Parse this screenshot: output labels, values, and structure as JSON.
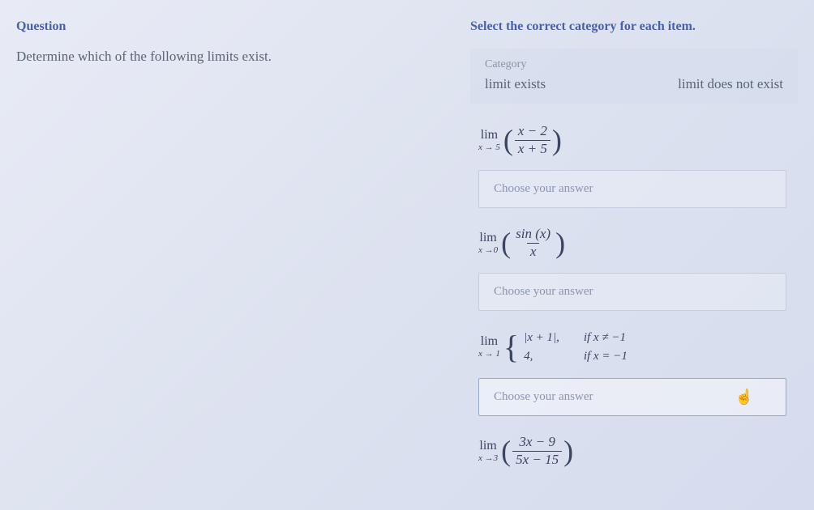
{
  "left": {
    "heading": "Question",
    "text": "Determine which of the following limits exist."
  },
  "right": {
    "instruction": "Select the correct category for each item.",
    "category": {
      "label": "Category",
      "opt1": "limit exists",
      "opt2": "limit does not exist"
    },
    "items": [
      {
        "lim_var": "x → 5",
        "frac_num": "x − 2",
        "frac_den": "x + 5",
        "placeholder": "Choose your answer"
      },
      {
        "lim_var": "x →0",
        "frac_num": "sin (x)",
        "frac_den": "x",
        "placeholder": "Choose your answer"
      },
      {
        "lim_var": "x → 1",
        "piece1_val": "|x + 1|,",
        "piece1_cond": "if x ≠ −1",
        "piece2_val": "4,",
        "piece2_cond": "if x = −1",
        "placeholder": "Choose your answer"
      },
      {
        "lim_var": "x →3",
        "frac_num": "3x − 9",
        "frac_den": "5x − 15"
      }
    ],
    "lim_label": "lim"
  }
}
